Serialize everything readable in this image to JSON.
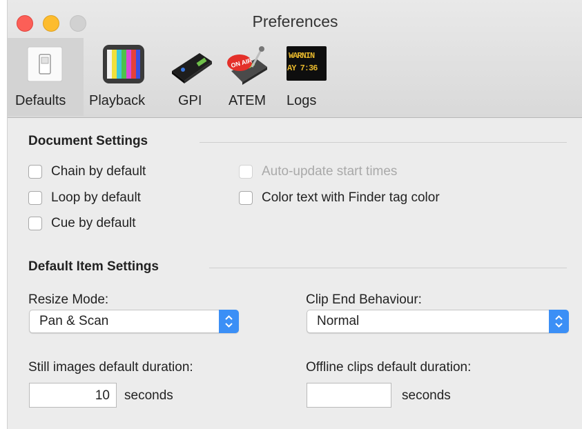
{
  "window": {
    "title": "Preferences"
  },
  "toolbar": {
    "tabs": [
      {
        "label": "Defaults",
        "icon": "switch-icon",
        "selected": true
      },
      {
        "label": "Playback",
        "icon": "tv-test-pattern-icon",
        "selected": false
      },
      {
        "label": "GPI",
        "icon": "gpi-box-icon",
        "selected": false
      },
      {
        "label": "ATEM",
        "icon": "on-air-switcher-icon",
        "selected": false
      },
      {
        "label": "Logs",
        "icon": "led-sign-icon",
        "selected": false
      }
    ],
    "logs_icon_text_1": "WARNIN",
    "logs_icon_text_2": "AY 7:36"
  },
  "document_settings": {
    "title": "Document Settings",
    "chain": {
      "label": "Chain by default",
      "checked": false
    },
    "loop": {
      "label": "Loop by default",
      "checked": false
    },
    "cue": {
      "label": "Cue by default",
      "checked": false
    },
    "auto_update": {
      "label": "Auto-update start times",
      "checked": false,
      "enabled": false
    },
    "color_text": {
      "label": "Color text with Finder tag color",
      "checked": false
    }
  },
  "default_item_settings": {
    "title": "Default Item Settings",
    "resize_mode": {
      "label": "Resize Mode:",
      "value": "Pan & Scan"
    },
    "clip_end": {
      "label": "Clip End Behaviour:",
      "value": "Normal"
    },
    "still_duration": {
      "label": "Still images default duration:",
      "value": "10",
      "unit": "seconds"
    },
    "offline_duration": {
      "label": "Offline clips default duration:",
      "value": "",
      "unit": "seconds"
    }
  },
  "colors": {
    "accent": "#3b8ff6",
    "close": "#fc5f57",
    "minimize": "#fdbc2e",
    "disabled_zoom": "#d1d1d1"
  }
}
